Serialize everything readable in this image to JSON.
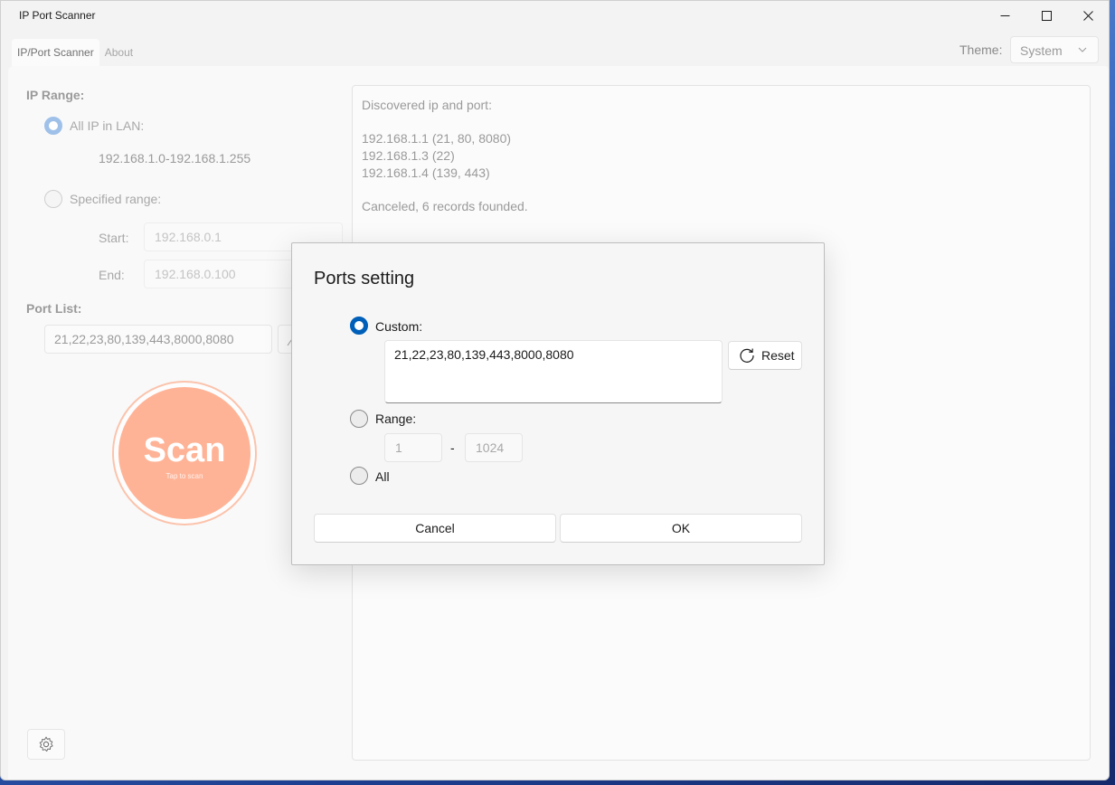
{
  "window": {
    "title": "IP Port Scanner"
  },
  "tabs": [
    {
      "label": "IP/Port Scanner",
      "active": true
    },
    {
      "label": "About",
      "active": false
    }
  ],
  "theme": {
    "label": "Theme:",
    "value": "System"
  },
  "ip_range": {
    "label": "IP Range:",
    "all_ip_label": "All IP in LAN:",
    "all_ip_value": "192.168.1.0-192.168.1.255",
    "specified_label": "Specified range:",
    "start_label": "Start:",
    "start_placeholder": "192.168.0.1",
    "end_label": "End:",
    "end_placeholder": "192.168.0.100"
  },
  "port_list": {
    "label": "Port List:",
    "value": "21,22,23,80,139,443,8000,8080"
  },
  "scan_button": {
    "title": "Scan",
    "subtitle": "Tap to scan"
  },
  "results": {
    "header": "Discovered ip and port:",
    "items": [
      "192.168.1.1 (21, 80, 8080)",
      "192.168.1.3 (22)",
      "192.168.1.4 (139, 443)"
    ],
    "status": "Canceled, 6 records founded."
  },
  "dialog": {
    "title": "Ports setting",
    "custom_label": "Custom:",
    "custom_value": "21,22,23,80,139,443,8000,8080",
    "reset_label": "Reset",
    "range_label": "Range:",
    "range_from_placeholder": "1",
    "range_separator": "-",
    "range_to_placeholder": "1024",
    "all_label": "All",
    "selected": "custom",
    "cancel_label": "Cancel",
    "ok_label": "OK"
  },
  "colors": {
    "accent": "#005fb8",
    "scan_fill": "#ffb396",
    "scan_ring": "#fbc3ac"
  }
}
